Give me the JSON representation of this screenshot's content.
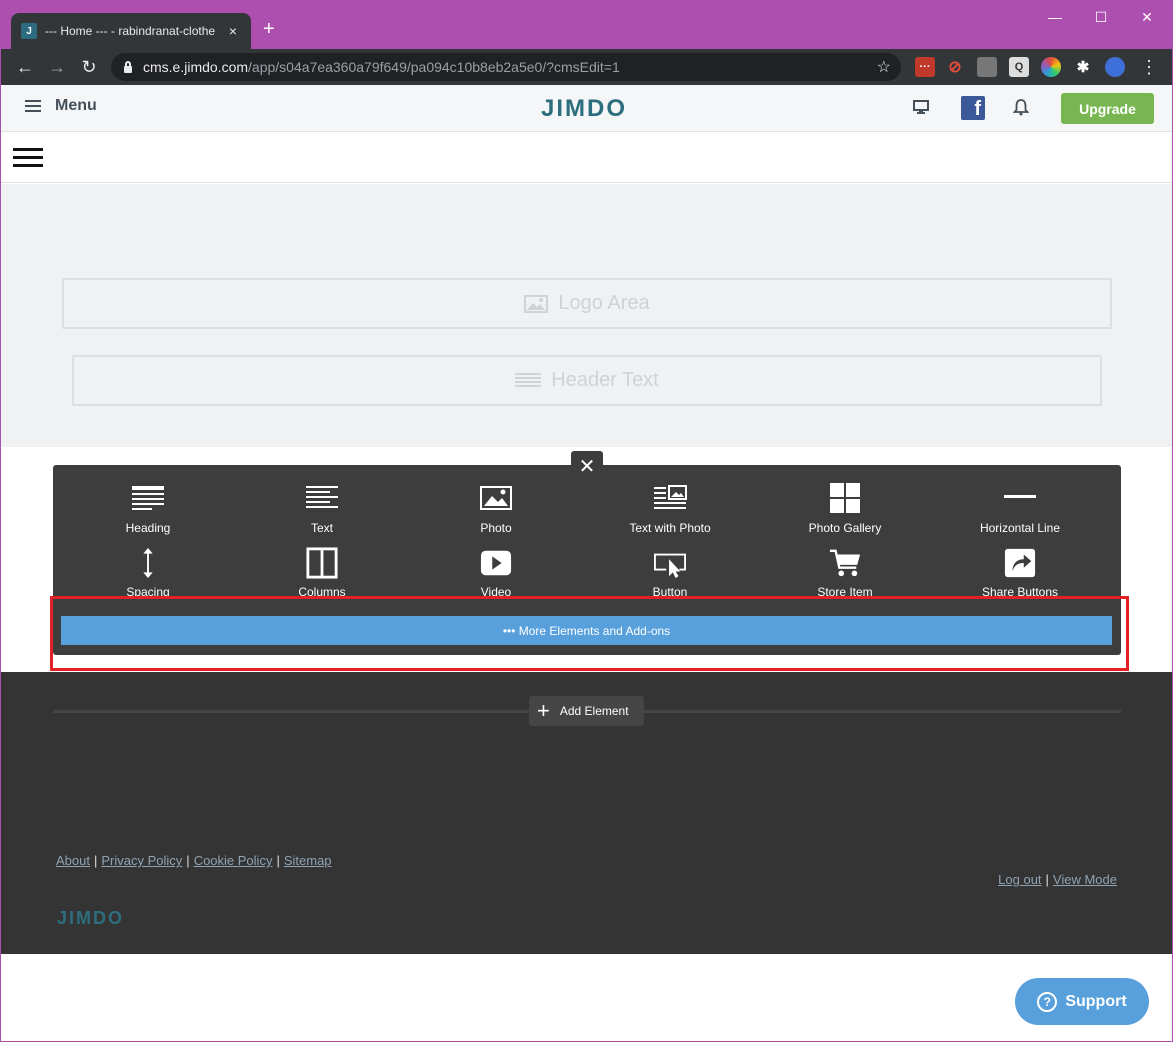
{
  "browser": {
    "tab_title": "--- Home --- - rabindranat-clothe",
    "tab_favicon": "J",
    "url_domain": "cms.e.jimdo.com",
    "url_path": "/app/s04a7ea360a79f649/pa094c10b8eb2a5e0/?cmsEdit=1",
    "new_tab_icon": "+",
    "close_tab_icon": "×",
    "back_icon": "←",
    "forward_icon": "→",
    "reload_icon": "↻",
    "star_icon": "☆",
    "menu_icon": "⋮",
    "minimize_icon": "—",
    "maximize_icon": "☐",
    "close_window_icon": "✕"
  },
  "jimdo_bar": {
    "menu_label": "Menu",
    "logo": "JIMDO",
    "facebook_glyph": "f",
    "upgrade_label": "Upgrade"
  },
  "header": {
    "logo_area_label": "Logo Area",
    "header_text_label": "Header Text"
  },
  "palette": {
    "close_icon": "✕",
    "items": [
      {
        "label": "Heading",
        "icon": "heading-icon"
      },
      {
        "label": "Text",
        "icon": "text-icon"
      },
      {
        "label": "Photo",
        "icon": "photo-icon"
      },
      {
        "label": "Text with Photo",
        "icon": "text-with-photo-icon"
      },
      {
        "label": "Photo Gallery",
        "icon": "photo-gallery-icon"
      },
      {
        "label": "Horizontal Line",
        "icon": "horizontal-line-icon"
      },
      {
        "label": "Spacing",
        "icon": "spacing-icon"
      },
      {
        "label": "Columns",
        "icon": "columns-icon"
      },
      {
        "label": "Video",
        "icon": "video-icon"
      },
      {
        "label": "Button",
        "icon": "button-icon"
      },
      {
        "label": "Store Item",
        "icon": "store-item-icon"
      },
      {
        "label": "Share Buttons",
        "icon": "share-buttons-icon"
      }
    ],
    "more_label": "••• More Elements and Add-ons"
  },
  "footer": {
    "add_element_label": "Add Element",
    "links": [
      "About",
      "Privacy Policy",
      "Cookie Policy",
      "Sitemap"
    ],
    "right_links": [
      "Log out",
      "View Mode"
    ],
    "separator": "|",
    "logo": "JIMDO"
  },
  "support": {
    "label": "Support",
    "icon_glyph": "?"
  },
  "colors": {
    "titlebar": "#ad4fae",
    "upgrade": "#78b652",
    "accent_blue": "#58a0dc",
    "highlight": "#e32025",
    "jimdo_teal": "#2d6e7e"
  }
}
